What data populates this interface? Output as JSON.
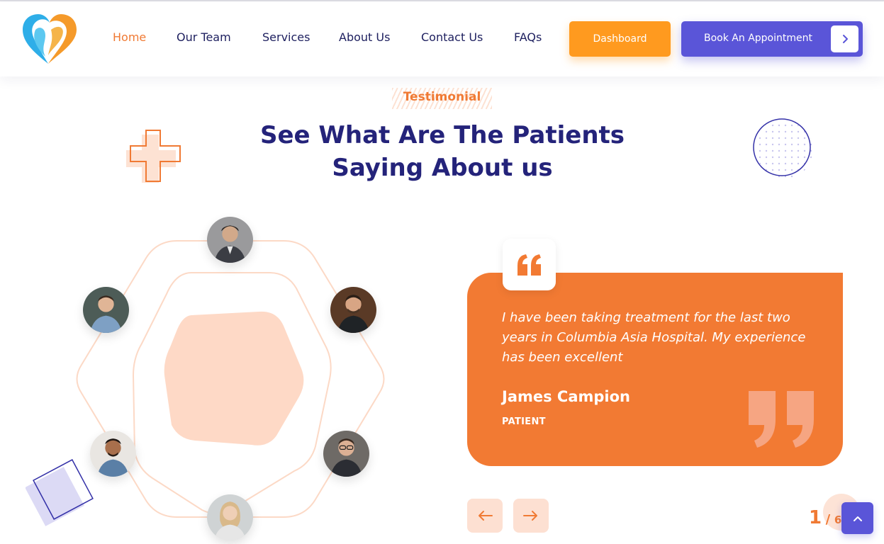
{
  "header": {
    "nav": [
      {
        "label": "Home",
        "active": true
      },
      {
        "label": "Our Team"
      },
      {
        "label": "Services"
      },
      {
        "label": "About Us"
      },
      {
        "label": "Contact Us"
      },
      {
        "label": "FAQs"
      }
    ],
    "dashboard_label": "Dashboard",
    "book_label": "Book An Appointment"
  },
  "section": {
    "tag": "Testimonial",
    "title_line1": "See What Are The Patients",
    "title_line2": "Saying About us"
  },
  "testimonial": {
    "text": "I have been taking treatment for the last two years in Columbia Asia Hospital. My experience has been excellent",
    "author": "James Campion",
    "role": "PATIENT"
  },
  "pagination": {
    "current": "1",
    "separator": "/",
    "total": "6"
  },
  "colors": {
    "accent": "#f27a33",
    "navy": "#24237a",
    "purple": "#5a55d8",
    "orange_button": "#ff9a1f"
  },
  "icons": [
    "heart-logo-icon",
    "chevron-right-icon",
    "quote-open-icon",
    "quote-close-icon",
    "arrow-left-icon",
    "arrow-right-icon",
    "chevron-up-icon",
    "plus-decoration-icon"
  ]
}
